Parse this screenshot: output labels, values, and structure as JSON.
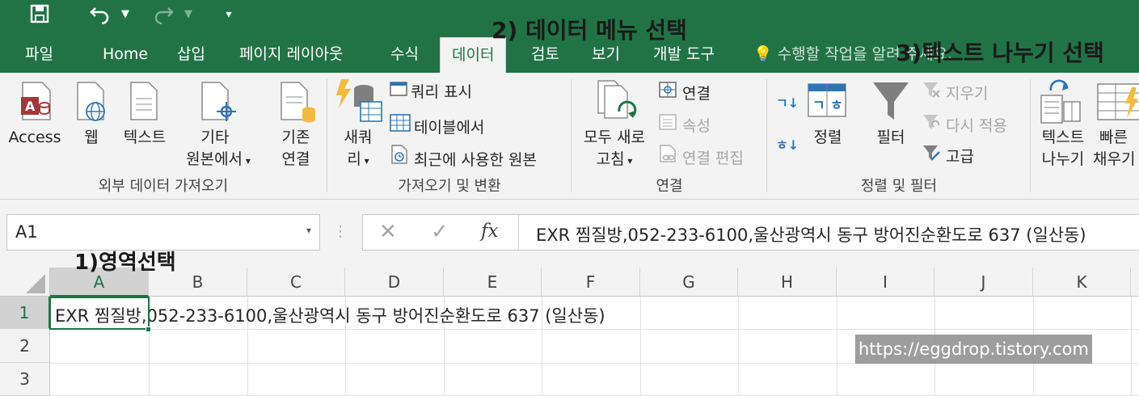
{
  "quick_access": {
    "save_icon": "save-icon",
    "undo_icon": "undo-icon",
    "redo_icon": "redo-icon",
    "customize_icon": "customize-icon"
  },
  "tabs": [
    {
      "label": "파일"
    },
    {
      "label": "Home"
    },
    {
      "label": "삽입"
    },
    {
      "label": "페이지 레이아웃"
    },
    {
      "label": "수식"
    },
    {
      "label": "데이터"
    },
    {
      "label": "검토"
    },
    {
      "label": "보기"
    },
    {
      "label": "개발 도구"
    }
  ],
  "tell_me": "수행할 작업을 알려 주세요.",
  "ribbon": {
    "get_external": {
      "access": "Access",
      "web": "웹",
      "text": "텍스트",
      "other_1": "기타",
      "other_2": "원본에서",
      "existing_1": "기존",
      "existing_2": "연결",
      "group": "외부 데이터 가져오기"
    },
    "get_transform": {
      "new_query_1": "새쿼",
      "new_query_2": "리",
      "show_queries": "쿼리 표시",
      "from_table": "테이블에서",
      "recent_sources": "최근에 사용한 원본",
      "group": "가져오기 및 변환"
    },
    "connections": {
      "refresh_all_1": "모두 새로",
      "refresh_all_2": "고침",
      "connections": "연결",
      "properties": "속성",
      "edit_links": "연결 편집",
      "group": "연결"
    },
    "sort_filter": {
      "sort": "정렬",
      "filter": "필터",
      "clear": "지우기",
      "reapply": "다시 적용",
      "advanced": "고급",
      "group": "정렬 및 필터"
    },
    "data_tools": {
      "text_to_columns_1": "텍스트",
      "text_to_columns_2": "나누기",
      "flash_fill_1": "빠른",
      "flash_fill_2": "채우기"
    }
  },
  "name_box": "A1",
  "formula": "EXR 찜질방,052-233-6100,울산광역시 동구 방어진순환도로 637 (일산동)",
  "columns": [
    "A",
    "B",
    "C",
    "D",
    "E",
    "F",
    "G",
    "H",
    "I",
    "J",
    "K"
  ],
  "rows": [
    "1",
    "2",
    "3"
  ],
  "cell_a1": "EXR 찜질방,052-233-6100,울산광역시 동구 방어진순환도로 637 (일산동)",
  "annotations": {
    "step1": "1)영역선택",
    "step2": "2) 데이터 메뉴 선택",
    "step3": "3)텍스트 나누기 선택"
  },
  "watermark": "https://eggdrop.tistory.com",
  "colors": {
    "excel_green": "#217346",
    "ribbon_bg": "#f3f3f3",
    "annotation": "#1a1a1a"
  }
}
